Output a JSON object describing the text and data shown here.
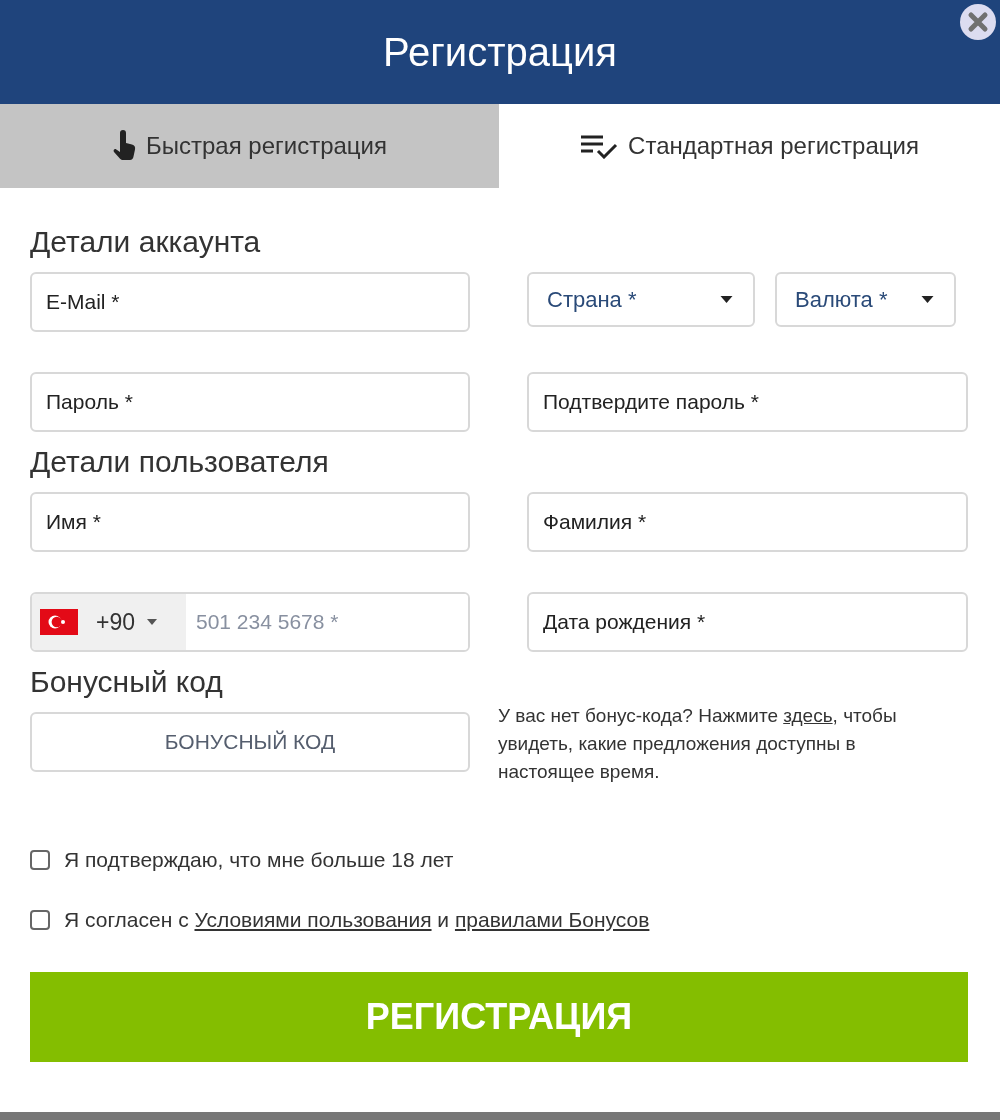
{
  "window": {
    "title": "Регистрация"
  },
  "tabs": [
    {
      "label": "Быстрая регистрация",
      "selected": false
    },
    {
      "label": "Стандартная регистрация",
      "selected": true
    }
  ],
  "account": {
    "heading": "Детали аккаунта",
    "email": {
      "placeholder": "E-Mail *"
    },
    "country": {
      "value": "Страна *"
    },
    "currency": {
      "value": "Валюта *"
    },
    "password": {
      "placeholder": "Пароль *"
    },
    "confirm_password": {
      "placeholder": "Подтвердите пароль *"
    }
  },
  "user": {
    "heading": "Детали пользователя",
    "first_name": {
      "placeholder": "Имя *"
    },
    "last_name": {
      "placeholder": "Фамилия *"
    },
    "phone": {
      "code": "+90",
      "placeholder": "501 234 5678 *"
    },
    "birth_date": {
      "placeholder": "Дата рождения *"
    }
  },
  "bonus": {
    "heading": "Бонусный код",
    "field": {
      "placeholder": "БОНУСНЫЙ КОД"
    },
    "hint": [
      {
        "kind": "text",
        "text": "У вас нет бонус-кода? Нажмите "
      },
      {
        "kind": "link",
        "text": "здесь"
      },
      {
        "kind": "text",
        "text": ", чтобы увидеть, какие предложения доступны в настоящее время."
      }
    ]
  },
  "consents": [
    {
      "checked": false,
      "parts": [
        {
          "kind": "text",
          "text": "Я подтверждаю, что мне больше 18 лет"
        }
      ]
    },
    {
      "checked": false,
      "parts": [
        {
          "kind": "text",
          "text": "Я согласен с "
        },
        {
          "kind": "link",
          "text": "Условиями пользования"
        },
        {
          "kind": "text",
          "text": " и "
        },
        {
          "kind": "link",
          "text": "правилами Бонусов"
        }
      ]
    }
  ],
  "submit": {
    "label": "РЕГИСТРАЦИЯ"
  }
}
